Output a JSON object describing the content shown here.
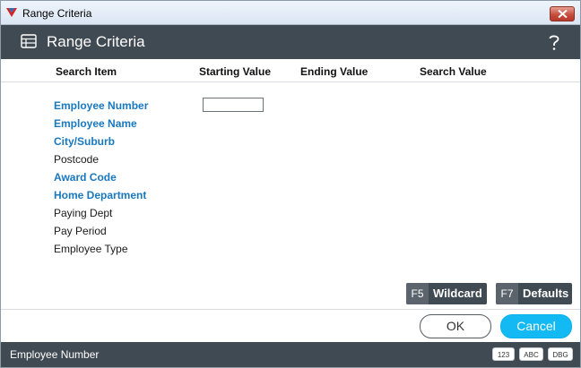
{
  "window": {
    "title": "Range Criteria"
  },
  "header": {
    "title": "Range Criteria"
  },
  "columns": {
    "search_item": "Search Item",
    "starting_value": "Starting Value",
    "ending_value": "Ending Value",
    "search_value": "Search Value"
  },
  "items": [
    {
      "label": "Employee Number",
      "style": "link"
    },
    {
      "label": "Employee Name",
      "style": "link"
    },
    {
      "label": "City/Suburb",
      "style": "link"
    },
    {
      "label": "Postcode",
      "style": "plain"
    },
    {
      "label": "Award Code",
      "style": "link"
    },
    {
      "label": "Home Department",
      "style": "link"
    },
    {
      "label": "Paying Dept",
      "style": "plain"
    },
    {
      "label": "Pay Period",
      "style": "plain"
    },
    {
      "label": "Employee Type",
      "style": "plain"
    }
  ],
  "starting_input": {
    "value": ""
  },
  "function_keys": {
    "wildcard": {
      "key": "F5",
      "label": "Wildcard"
    },
    "defaults": {
      "key": "F7",
      "label": "Defaults"
    }
  },
  "buttons": {
    "ok": "OK",
    "cancel": "Cancel"
  },
  "status": {
    "text": "Employee Number",
    "badges": [
      "123",
      "ABC",
      "DBG"
    ]
  },
  "colors": {
    "header_bg": "#404a53",
    "link_text": "#1878c0",
    "cancel_bg": "#12b9f3"
  },
  "icons": {
    "app": "app-logo-icon",
    "header": "table-icon",
    "help": "help-icon",
    "close": "close-icon"
  }
}
